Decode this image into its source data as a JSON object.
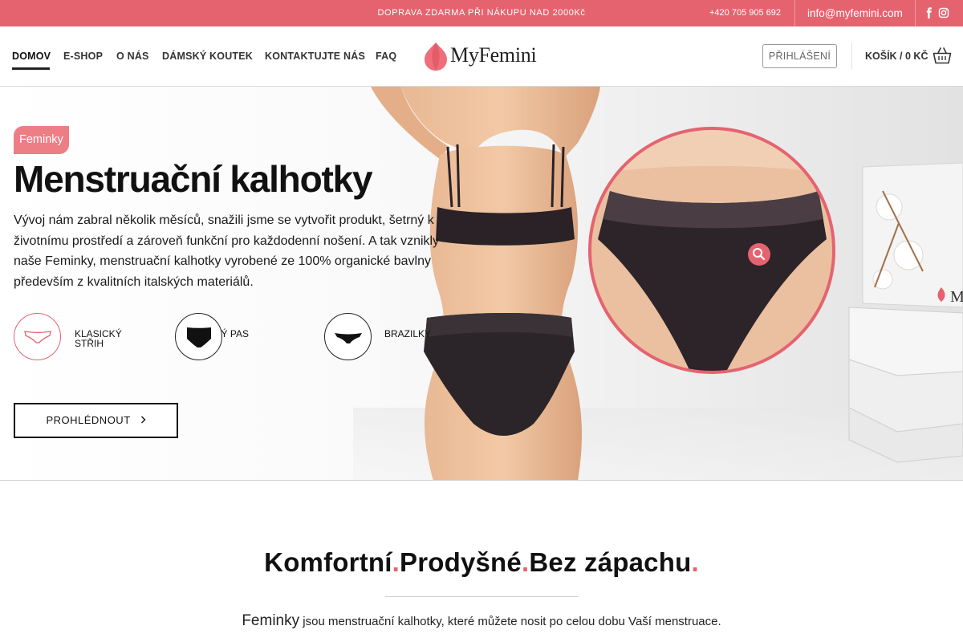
{
  "topbar": {
    "promo": "DOPRAVA ZDARMA PŘI NÁKUPU NAD 2000Kč",
    "phone": "+420 705 905 692",
    "email": "info@myfemini.com",
    "social_icons": [
      "facebook-icon",
      "instagram-icon"
    ]
  },
  "nav": {
    "items": [
      {
        "label": "DOMOV",
        "active": true
      },
      {
        "label": "E-SHOP"
      },
      {
        "label": "O NÁS"
      },
      {
        "label": "DÁMSKÝ KOUTEK"
      },
      {
        "label": "KONTAKTUJTE NÁS"
      },
      {
        "label": "FAQ"
      }
    ]
  },
  "logo": {
    "text": "MyFemini"
  },
  "header": {
    "login_label": "PŘIHLÁŠENÍ",
    "cart_label": "KOŠÍK / 0 KČ"
  },
  "hero": {
    "badge": "Feminky",
    "title": "Menstruační kalhotky",
    "description": "Vývoj nám zabral několik měsíců, snažili jsme se vytvořit produkt, šetrný k životnímu prostředí a zároveň funkční pro každodenní nošení. A tak vznikly naše Feminky, menstruační kalhotky vyrobené ze 100% organické bavlny především z kvalitních italských materiálů.",
    "types": [
      {
        "label_line1": "KLASICKÝ",
        "label_line2": "STŘIH"
      },
      {
        "label_line1": "VYSOKÝ PAS",
        "label_line2": ""
      },
      {
        "label_line1": "BRAZILKY",
        "label_line2": ""
      }
    ],
    "button_label": "PROHLÉDNOUT",
    "package_label": "M"
  },
  "tagline": {
    "part1": "Komfortní",
    "part2": "Prodyšné",
    "part3": "Bez zápachu",
    "dot": "."
  },
  "intro": {
    "brand": "Feminky",
    "text": " jsou menstruační kalhotky, které můžete nosit po celou dobu Vaší menstruace."
  },
  "colors": {
    "accent": "#e5636f",
    "badge": "#ee7e86",
    "text": "#111111"
  }
}
